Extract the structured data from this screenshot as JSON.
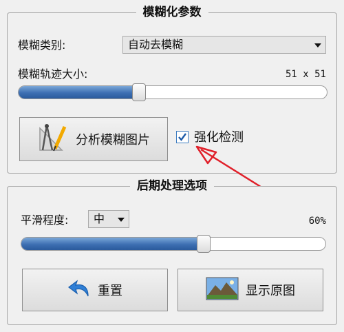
{
  "blur_params": {
    "title": "模糊化参数",
    "blur_type_label": "模糊类别:",
    "blur_type_value": "自动去模糊",
    "trail_size_label": "模糊轨迹大小:",
    "trail_size_value": "51 x 51",
    "trail_size_fraction": 0.39,
    "analyze_button_label": "分析模糊图片",
    "enhance_label": "强化检测",
    "enhance_checked": true
  },
  "post_process": {
    "title": "后期处理选项",
    "smooth_label": "平滑程度:",
    "smooth_value": "中",
    "smooth_percent_text": "60%",
    "smooth_fraction": 0.6,
    "reset_label": "重置",
    "show_original_label": "显示原图"
  },
  "icons": {
    "analyze": "drafting-tools-icon",
    "reset": "undo-arrow-icon",
    "show_original": "landscape-photo-icon",
    "annotation": "red-arrow-icon"
  },
  "colors": {
    "fill": "#3d6fb2",
    "checkbox_border": "#3b7bbf",
    "arrow": "#e0202a"
  }
}
